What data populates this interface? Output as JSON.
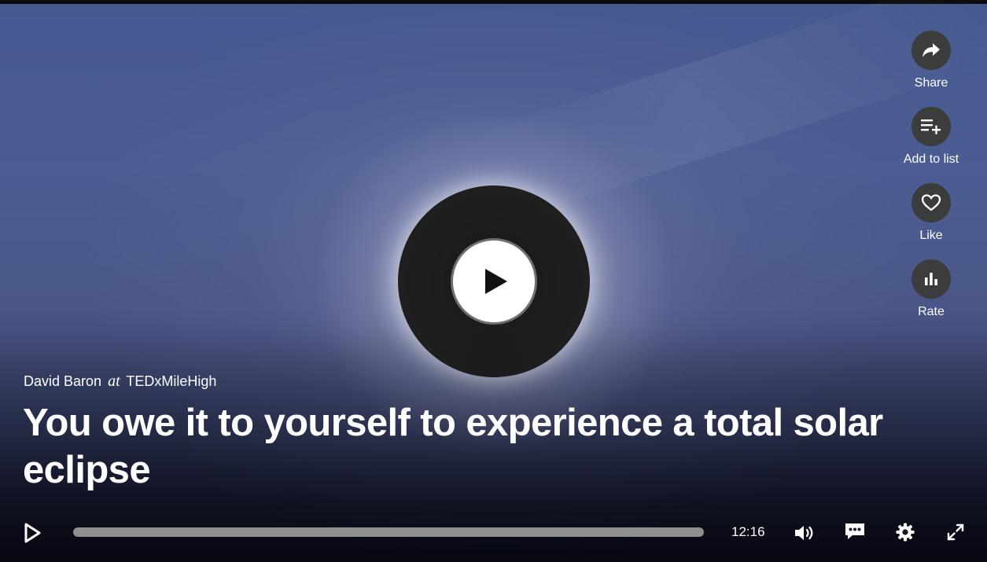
{
  "talk": {
    "speaker": "David Baron",
    "at_word": "at",
    "event": "TEDxMileHigh",
    "title": "You owe it to yourself to experience a total solar eclipse"
  },
  "side_actions": [
    {
      "label": "Share",
      "icon": "share-icon"
    },
    {
      "label": "Add to list",
      "icon": "add-to-list-icon"
    },
    {
      "label": "Like",
      "icon": "heart-icon"
    },
    {
      "label": "Rate",
      "icon": "bar-chart-icon"
    }
  ],
  "player": {
    "duration": "12:16",
    "progress": 0.0,
    "icons": [
      "play-icon",
      "volume-icon",
      "subtitles-icon",
      "settings-icon",
      "fullscreen-icon"
    ]
  },
  "colors": {
    "accent": "#e62b1e",
    "icon_circle": "#3c3c3c",
    "progress_track": "#8f8f8f"
  }
}
